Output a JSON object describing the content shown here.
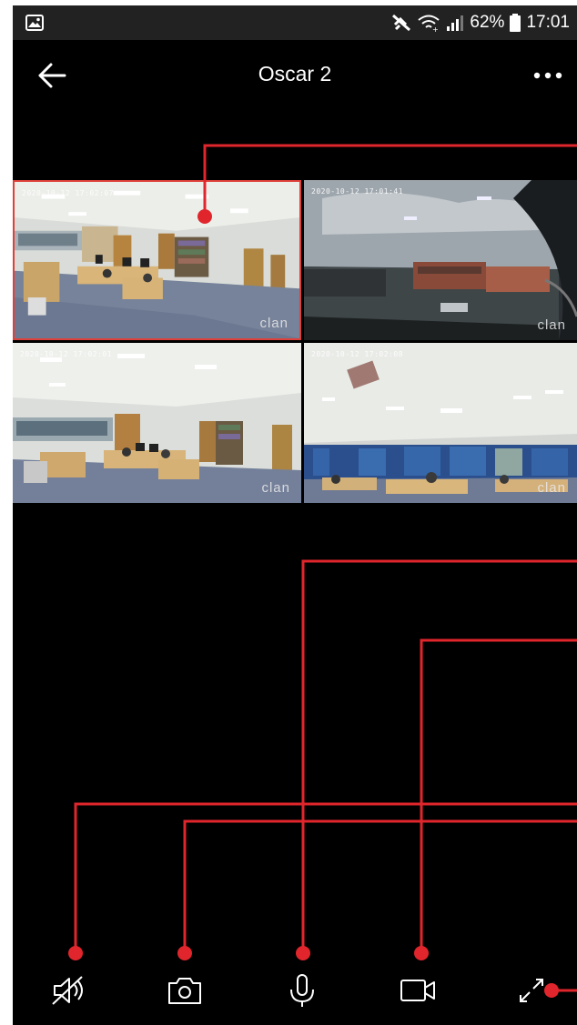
{
  "status_bar": {
    "battery": "62%",
    "time": "17:01",
    "icons": [
      "image-icon",
      "mute-icon",
      "wifi-icon",
      "signal-icon",
      "battery-icon"
    ]
  },
  "header": {
    "title": "Oscar 2",
    "back_icon": "arrow-left-icon",
    "more_icon": "more-dots-icon"
  },
  "cameras": [
    {
      "timestamp": "2020-10-12 17:02:07",
      "watermark": "clan",
      "selected": true
    },
    {
      "timestamp": "2020-10-12 17:01:41",
      "watermark": "clan",
      "selected": false
    },
    {
      "timestamp": "2020-10-12 17:02:01",
      "watermark": "clan",
      "selected": false
    },
    {
      "timestamp": "2020-10-12 17:02:08",
      "watermark": "clan",
      "selected": false
    }
  ],
  "toolbar": {
    "items": [
      "speaker-mute-icon",
      "camera-snapshot-icon",
      "microphone-icon",
      "video-record-icon",
      "fullscreen-icon"
    ]
  },
  "colors": {
    "background": "#000000",
    "status_bar": "#222222",
    "accent_red": "#e0403a",
    "text": "#ffffff"
  }
}
